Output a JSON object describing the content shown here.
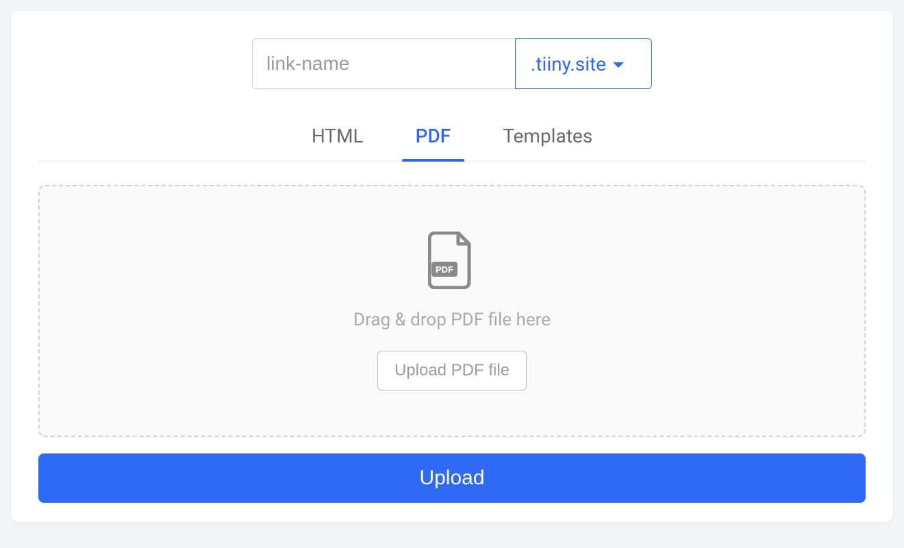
{
  "url": {
    "placeholder": "link-name",
    "domain": ".tiiny.site"
  },
  "tabs": {
    "html": "HTML",
    "pdf": "PDF",
    "templates": "Templates",
    "active": "pdf"
  },
  "dropzone": {
    "text": "Drag & drop PDF file here",
    "upload_file_label": "Upload PDF file"
  },
  "submit": {
    "label": "Upload"
  },
  "icons": {
    "pdf": "pdf-file-icon",
    "caret": "caret-down-icon"
  }
}
